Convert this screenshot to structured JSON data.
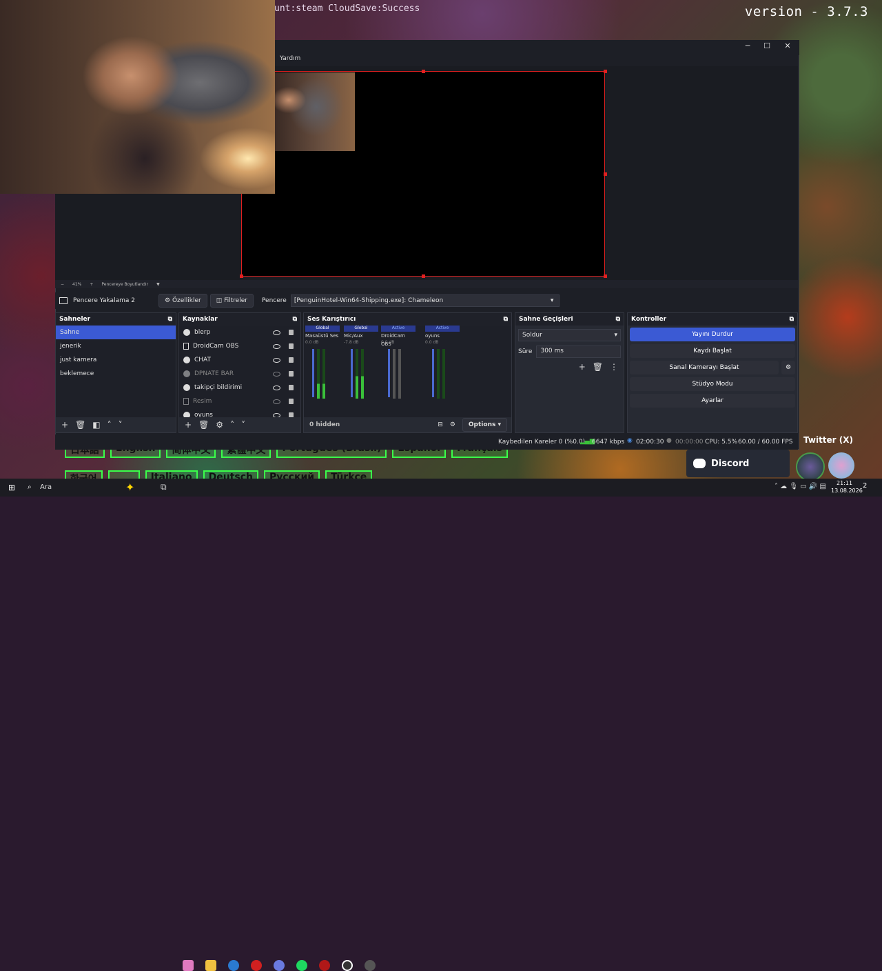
{
  "desktop": {
    "version_text": "version - 3.7.3",
    "cloud_text": "unt:steam  CloudSave:Success",
    "twitter_label": "Twitter (X)",
    "discord_label": "Discord",
    "languages": [
      "日本語",
      "English",
      "简体中文",
      "繁體中文",
      "Português (Brasil)",
      "Español",
      "Français"
    ],
    "languages_row2": [
      "한국어",
      "",
      "Italiano",
      "Deutsch",
      "Русский",
      "Türkçe"
    ]
  },
  "obs": {
    "menu_help": "Yardım",
    "zoom": {
      "percent": "41%",
      "label": "Pencereye Boyutlandır"
    },
    "source_bar": {
      "source_name": "Pencere Yakalama 2",
      "properties_label": "Özellikler",
      "filters_label": "Filtreler",
      "window_label": "Pencere",
      "window_value": "[PenguinHotel-Win64-Shipping.exe]: Chameleon"
    },
    "scenes": {
      "title": "Sahneler",
      "items": [
        "Sahne",
        "jenerik",
        "just kamera",
        "beklemece"
      ],
      "selected": "Sahne"
    },
    "sources": {
      "title": "Kaynaklar",
      "items": [
        {
          "name": "blerp",
          "icon": "globe-icon",
          "visible": true
        },
        {
          "name": "DroidCam OBS",
          "icon": "document-icon",
          "visible": true
        },
        {
          "name": "CHAT",
          "icon": "globe-icon",
          "visible": true
        },
        {
          "name": "DPNATE BAR",
          "icon": "globe-icon",
          "visible": false
        },
        {
          "name": "takipçi bildirimi",
          "icon": "globe-icon",
          "visible": true
        },
        {
          "name": "Resim",
          "icon": "image-icon",
          "visible": false
        },
        {
          "name": "oyuns",
          "icon": "globe-icon",
          "visible": true
        }
      ]
    },
    "mixer": {
      "title": "Ses Karıştırıcı",
      "channels": [
        {
          "tag": "Global",
          "name": "Masaüstü Ses",
          "db": "0.0 dB",
          "level": 0.3
        },
        {
          "tag": "Global",
          "name": "Mic/Aux",
          "db": "-7.8 dB",
          "level": 0.45
        },
        {
          "tag": "Active",
          "name": "DroidCam OBS",
          "db": "0.0 dB",
          "level": 0.0
        },
        {
          "tag": "Active",
          "name": "oyuns",
          "db": "0.0 dB",
          "level": 0.0
        }
      ],
      "scale": [
        "0",
        "-6",
        "-12",
        "-18",
        "-24",
        "-30",
        "-36",
        "-42",
        "-48",
        "-54",
        "-60"
      ],
      "hidden_label": "0 hidden",
      "options_label": "Options"
    },
    "transitions": {
      "title": "Sahne Geçişleri",
      "selected": "Soldur",
      "duration_label": "Süre",
      "duration_value": "300 ms"
    },
    "controls": {
      "title": "Kontroller",
      "stop_stream": "Yayını Durdur",
      "start_record": "Kaydı Başlat",
      "start_virtual_cam": "Sanal Kamerayı Başlat",
      "studio_mode": "Stüdyo Modu",
      "settings": "Ayarlar"
    },
    "status": {
      "dropped_frames": "Kaybedilen Kareler 0 (%0.0)",
      "bitrate": "6647 kbps",
      "stream_time": "02:00:30",
      "record_time": "00:00:00",
      "cpu": "CPU: 5.5%",
      "fps": "60.00 / 60.00 FPS"
    }
  },
  "taskbar": {
    "search_placeholder": "Ara",
    "time": "21:11",
    "date": "13.08.2026",
    "notification_count": "2"
  },
  "colors": {
    "accent": "#3b5ad4",
    "canvas_border": "#e02020"
  }
}
